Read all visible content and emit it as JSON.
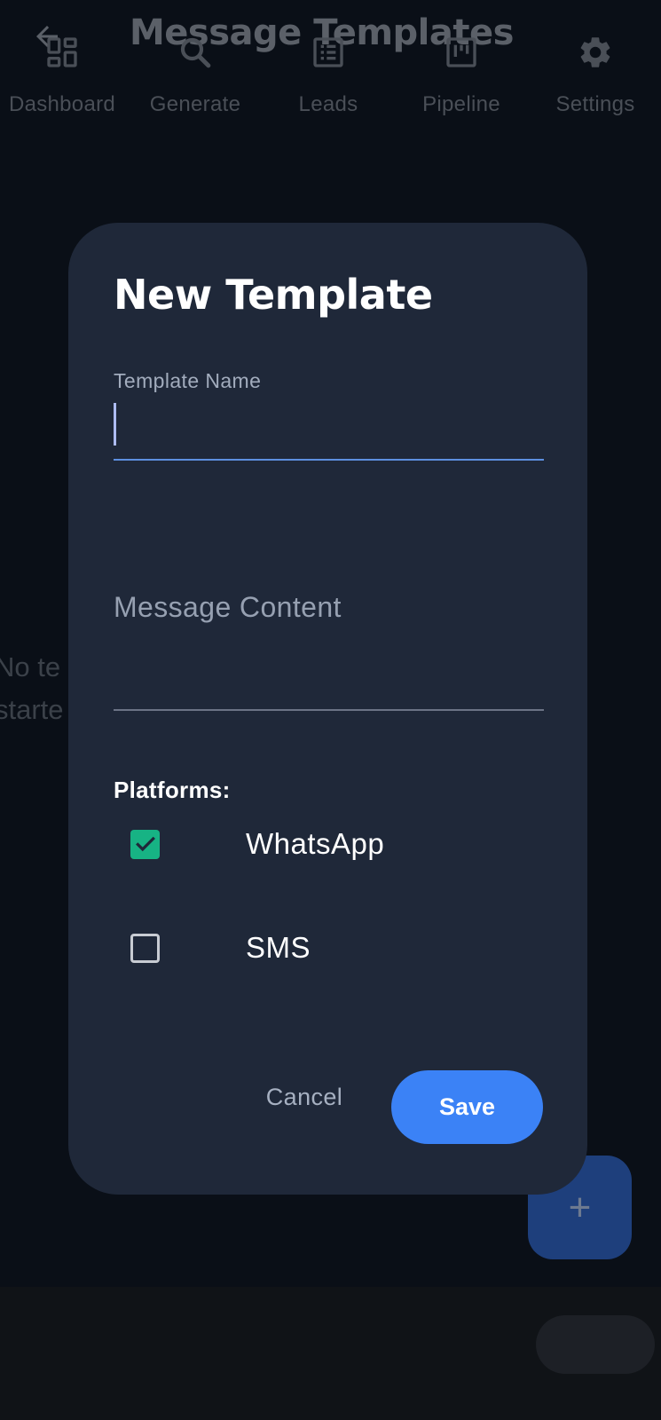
{
  "app_bar": {
    "title": "Message Templates",
    "back_icon": "arrow-left-icon"
  },
  "empty_state": {
    "line1": "No te",
    "line2": "starte"
  },
  "fab": {
    "icon": "plus-icon",
    "symbol": "+"
  },
  "dialog": {
    "title": "New Template",
    "template_name": {
      "label": "Template Name",
      "value": ""
    },
    "message_content": {
      "placeholder": "Message Content",
      "value": ""
    },
    "platforms_label": "Platforms:",
    "platforms": [
      {
        "label": "WhatsApp",
        "checked": true
      },
      {
        "label": "SMS",
        "checked": false
      }
    ],
    "cancel_label": "Cancel",
    "save_label": "Save"
  },
  "bottom_nav": {
    "items": [
      {
        "label": "Dashboard",
        "icon": "dashboard-icon"
      },
      {
        "label": "Generate",
        "icon": "search-icon"
      },
      {
        "label": "Leads",
        "icon": "list-icon"
      },
      {
        "label": "Pipeline",
        "icon": "pipeline-icon"
      },
      {
        "label": "Settings",
        "icon": "gear-icon"
      }
    ],
    "active": "Settings"
  },
  "colors": {
    "dialog_bg": "#1f2839",
    "accent": "#3b82f6",
    "checkbox_checked": "#17b384"
  }
}
